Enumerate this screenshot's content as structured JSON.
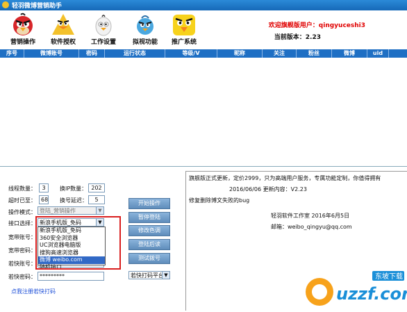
{
  "window": {
    "title": "轻羽微博营销助手"
  },
  "toolbar": {
    "items": [
      {
        "label": "营销操作",
        "icon": "red-angry-bird-icon",
        "color": "#d8262a"
      },
      {
        "label": "软件授权",
        "icon": "yellow-angry-bird-icon",
        "color": "#f3c12b"
      },
      {
        "label": "工作设置",
        "icon": "white-angry-bird-icon",
        "color": "#f2f2f2"
      },
      {
        "label": "拟视功能",
        "icon": "blue-angry-bird-icon",
        "color": "#4aa8e0"
      },
      {
        "label": "推广系统",
        "icon": "yellow-bird-big-icon",
        "color": "#f7d21c"
      }
    ],
    "user_line": "欢迎旗舰版用户：qingyuceshi3",
    "version_line": "当前版本：2.23"
  },
  "grid": {
    "columns": [
      "序号",
      "微博账号",
      "密码",
      "运行状态",
      "等级/V",
      "昵称",
      "关注",
      "粉丝",
      "微博",
      "uid"
    ]
  },
  "panel": {
    "thread_label": "线程数量：",
    "thread_value": "3",
    "ip_label": "换IP数量：",
    "ip_value": "202",
    "timeout_label": "超时已至：",
    "timeout_value": "68",
    "interval_label": "换号延迟：",
    "interval_value": "5",
    "mode_label": "操作模式：",
    "mode_value": "登陆_营销操作",
    "port_label": "接口选择：",
    "port_value": "新浪手机版_免码",
    "band_label1": "宽带账号：",
    "band_label2": "宽带密码：",
    "captcha_acct_label": "若快账号：",
    "captcha_acct_value": "ruokuaiceshi",
    "captcha_pwd_label": "若快密码：",
    "captcha_pwd_value": "*********",
    "captcha_platform": "若快打码平台",
    "register_link": "点我注册若快打码",
    "buttons": [
      "开始操作",
      "暂停登陆",
      "修改色调",
      "登陆后读",
      "测试拨号"
    ]
  },
  "dropdown": {
    "options": [
      "新浪手机版_免码",
      "360安全浏览器",
      "UC浏览器电脑版",
      "搜狗高速浏览器",
      "微博 weibo.com",
      "随机接口"
    ],
    "selected_index": 4
  },
  "log": {
    "line1": "旗舰版正式更新，定价2999，只为高端用户服务，专属功能定制，你值得拥有",
    "line2": "2016/06/06 更新内容：V2.23",
    "line3": "修复删除博文失败的bug",
    "line4": "轻羽软件工作室 2016年6月5日",
    "line5": "邮箱：weibo_qingyu@qq.com"
  },
  "watermark": {
    "text": "uzzf.com",
    "badge": "东坡下载",
    "color": "#1a8fd8"
  }
}
